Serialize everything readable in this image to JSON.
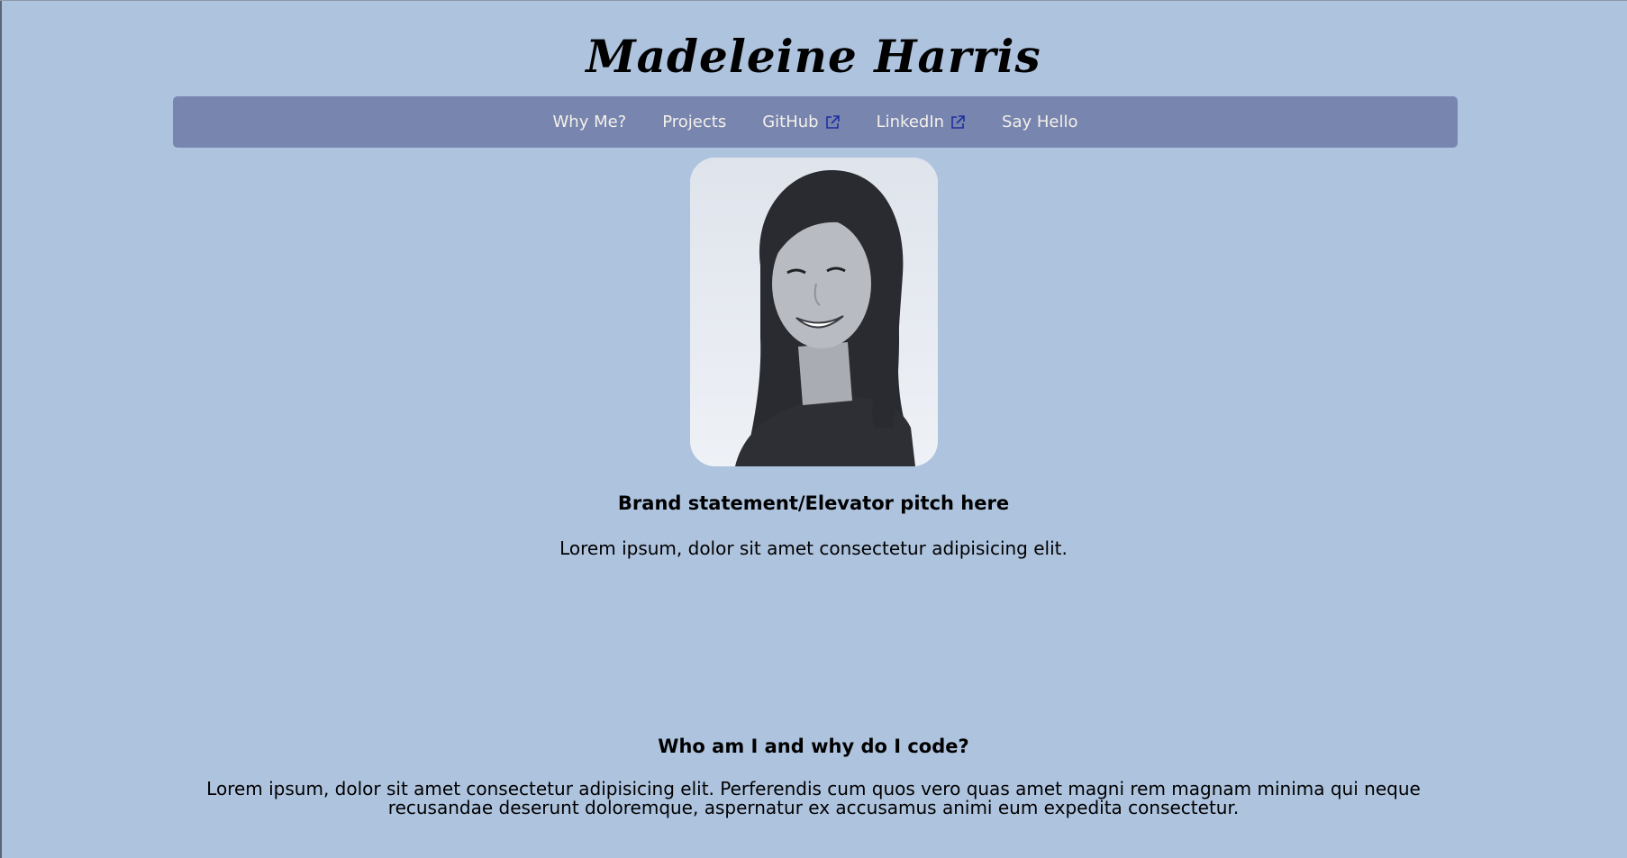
{
  "site": {
    "title": "Madeleine Harris"
  },
  "nav": {
    "items": [
      {
        "label": "Why Me?",
        "external": false
      },
      {
        "label": "Projects",
        "external": false
      },
      {
        "label": "GitHub",
        "external": true
      },
      {
        "label": "LinkedIn",
        "external": true
      },
      {
        "label": "Say Hello",
        "external": false
      }
    ],
    "external_icon": "external-link-icon"
  },
  "hero": {
    "photo_alt": "portrait-photo",
    "heading": "Brand statement/Elevator pitch here",
    "text": "Lorem ipsum, dolor sit amet consectetur adipisicing elit."
  },
  "about": {
    "heading": "Who am I and why do I code?",
    "text": "Lorem ipsum, dolor sit amet consectetur adipisicing elit. Perferendis cum quos vero quas amet magni rem magnam minima qui neque recusandae deserunt doloremque, aspernatur ex accusamus animi eum expedita consectetur."
  },
  "colors": {
    "background": "#aec3de",
    "navbar": "#7885ae",
    "nav_text": "#f4f0ea",
    "external_icon": "#1f2fa0"
  }
}
